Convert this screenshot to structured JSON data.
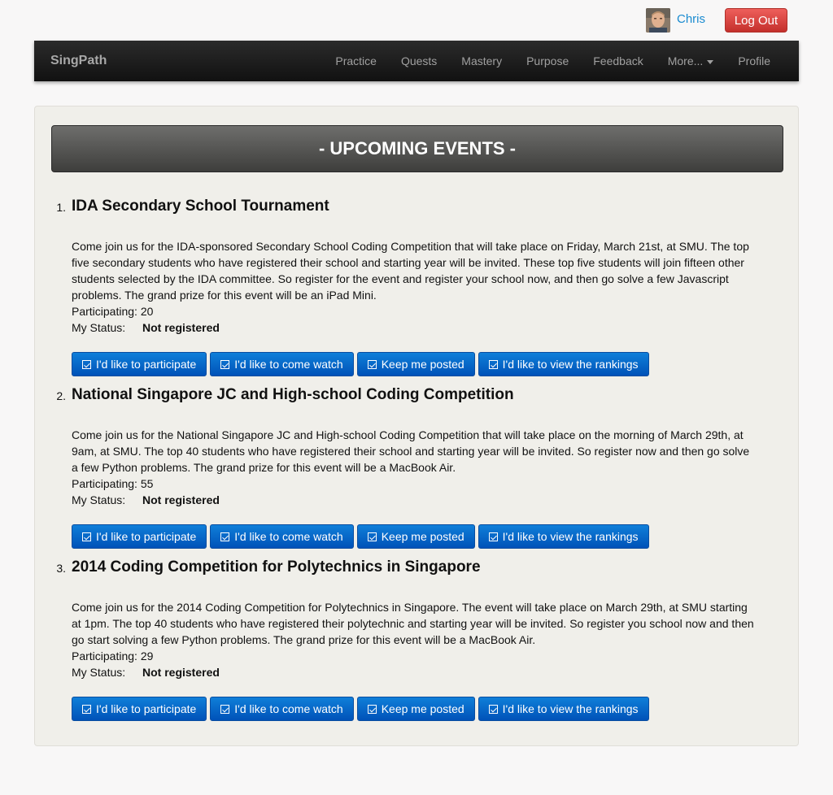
{
  "user": {
    "name": "Chris",
    "logout_label": "Log Out"
  },
  "navbar": {
    "brand": "SingPath",
    "items": [
      "Practice",
      "Quests",
      "Mastery",
      "Purpose",
      "Feedback",
      "More...",
      "Profile"
    ]
  },
  "banner": "- UPCOMING EVENTS -",
  "labels": {
    "participating": "Participating:",
    "my_status": "My Status:"
  },
  "buttons": {
    "participate": "I'd like to participate",
    "watch": "I'd like to come watch",
    "posted": "Keep me posted",
    "rankings": "I'd like to view the rankings"
  },
  "events": [
    {
      "num": "1.",
      "title": "IDA Secondary School Tournament",
      "description": "Come join us for the IDA-sponsored Secondary School Coding Competition that will take place on Friday, March 21st, at SMU. The top five secondary students who have registered their school and starting year will be invited. These top five students will join fifteen other students selected by the IDA committee. So register for the event and register your school now, and then go solve a few Javascript problems. The grand prize for this event will be an iPad Mini.",
      "participating": "20",
      "status": "Not registered"
    },
    {
      "num": "2.",
      "title": "National Singapore JC and High-school Coding Competition",
      "description": "Come join us for the National Singapore JC and High-school Coding Competition that will take place on the morning of March 29th, at 9am, at SMU. The top 40 students who have registered their school and starting year will be invited. So register now and then go solve a few Python problems. The grand prize for this event will be a MacBook Air.",
      "participating": "55",
      "status": "Not registered"
    },
    {
      "num": "3.",
      "title": "2014 Coding Competition for Polytechnics in Singapore",
      "description": "Come join us for the 2014 Coding Competition for Polytechnics in Singapore. The event will take place on March 29th, at SMU starting at 1pm. The top 40 students who have registered their polytechnic and starting year will be invited. So register you school now and then go start solving a few Python problems. The grand prize for this event will be a MacBook Air.",
      "participating": "29",
      "status": "Not registered"
    }
  ]
}
